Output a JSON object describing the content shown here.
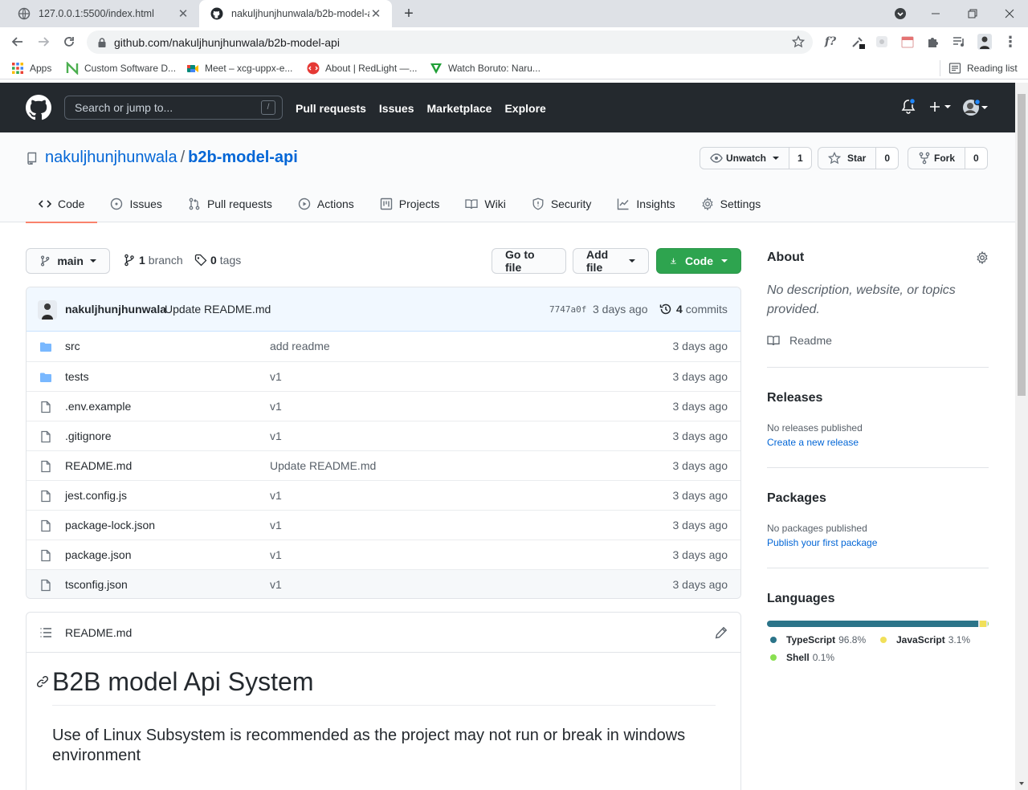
{
  "browser": {
    "tabs": [
      {
        "title": "127.0.0.1:5500/index.html"
      },
      {
        "title": "nakuljhunjhunwala/b2b-model-a"
      }
    ],
    "address": "github.com/nakuljhunjhunwala/b2b-model-api",
    "bookmarks": [
      {
        "label": "Apps"
      },
      {
        "label": "Custom Software D..."
      },
      {
        "label": "Meet – xcg-uppx-e..."
      },
      {
        "label": "About | RedLight —..."
      },
      {
        "label": "Watch Boruto: Naru..."
      }
    ],
    "reading_list": "Reading list"
  },
  "github": {
    "search_placeholder": "Search or jump to...",
    "search_key": "/",
    "nav": [
      "Pull requests",
      "Issues",
      "Marketplace",
      "Explore"
    ]
  },
  "repo": {
    "owner": "nakuljhunjhunwala",
    "separator": "/",
    "name": "b2b-model-api",
    "watch": {
      "label": "Unwatch",
      "count": "1"
    },
    "star": {
      "label": "Star",
      "count": "0"
    },
    "fork": {
      "label": "Fork",
      "count": "0"
    },
    "tabs": [
      {
        "label": "Code"
      },
      {
        "label": "Issues"
      },
      {
        "label": "Pull requests"
      },
      {
        "label": "Actions"
      },
      {
        "label": "Projects"
      },
      {
        "label": "Wiki"
      },
      {
        "label": "Security"
      },
      {
        "label": "Insights"
      },
      {
        "label": "Settings"
      }
    ]
  },
  "filenav": {
    "branch": "main",
    "branches_count": "1",
    "branches_label": "branch",
    "tags_count": "0",
    "tags_label": "tags",
    "go_to_file": "Go to file",
    "add_file": "Add file",
    "code": "Code"
  },
  "commit": {
    "author": "nakuljhunjhunwala",
    "message": "Update README.md",
    "sha": "7747a0f",
    "age": "3 days ago",
    "commits_count": "4",
    "commits_label": "commits"
  },
  "files": [
    {
      "name": "src",
      "type": "dir",
      "message": "add readme",
      "age": "3 days ago"
    },
    {
      "name": "tests",
      "type": "dir",
      "message": "v1",
      "age": "3 days ago"
    },
    {
      "name": ".env.example",
      "type": "file",
      "message": "v1",
      "age": "3 days ago"
    },
    {
      "name": ".gitignore",
      "type": "file",
      "message": "v1",
      "age": "3 days ago"
    },
    {
      "name": "README.md",
      "type": "file",
      "message": "Update README.md",
      "age": "3 days ago"
    },
    {
      "name": "jest.config.js",
      "type": "file",
      "message": "v1",
      "age": "3 days ago"
    },
    {
      "name": "package-lock.json",
      "type": "file",
      "message": "v1",
      "age": "3 days ago"
    },
    {
      "name": "package.json",
      "type": "file",
      "message": "v1",
      "age": "3 days ago"
    },
    {
      "name": "tsconfig.json",
      "type": "file",
      "message": "v1",
      "age": "3 days ago"
    }
  ],
  "readme": {
    "filename": "README.md",
    "title": "B2B model Api System",
    "subtitle": "Use of Linux Subsystem is recommended as the project may not run or break in windows environment"
  },
  "sidebar": {
    "about_title": "About",
    "about_desc": "No description, website, or topics provided.",
    "readme_link": "Readme",
    "releases_title": "Releases",
    "releases_text": "No releases published",
    "releases_link": "Create a new release",
    "packages_title": "Packages",
    "packages_text": "No packages published",
    "packages_link": "Publish your first package",
    "languages_title": "Languages",
    "languages": [
      {
        "name": "TypeScript",
        "percent": "96.8%",
        "value": 96.8,
        "color": "#2b7489"
      },
      {
        "name": "JavaScript",
        "percent": "3.1%",
        "value": 3.1,
        "color": "#f1e05a"
      },
      {
        "name": "Shell",
        "percent": "0.1%",
        "value": 0.1,
        "color": "#89e051"
      }
    ]
  }
}
